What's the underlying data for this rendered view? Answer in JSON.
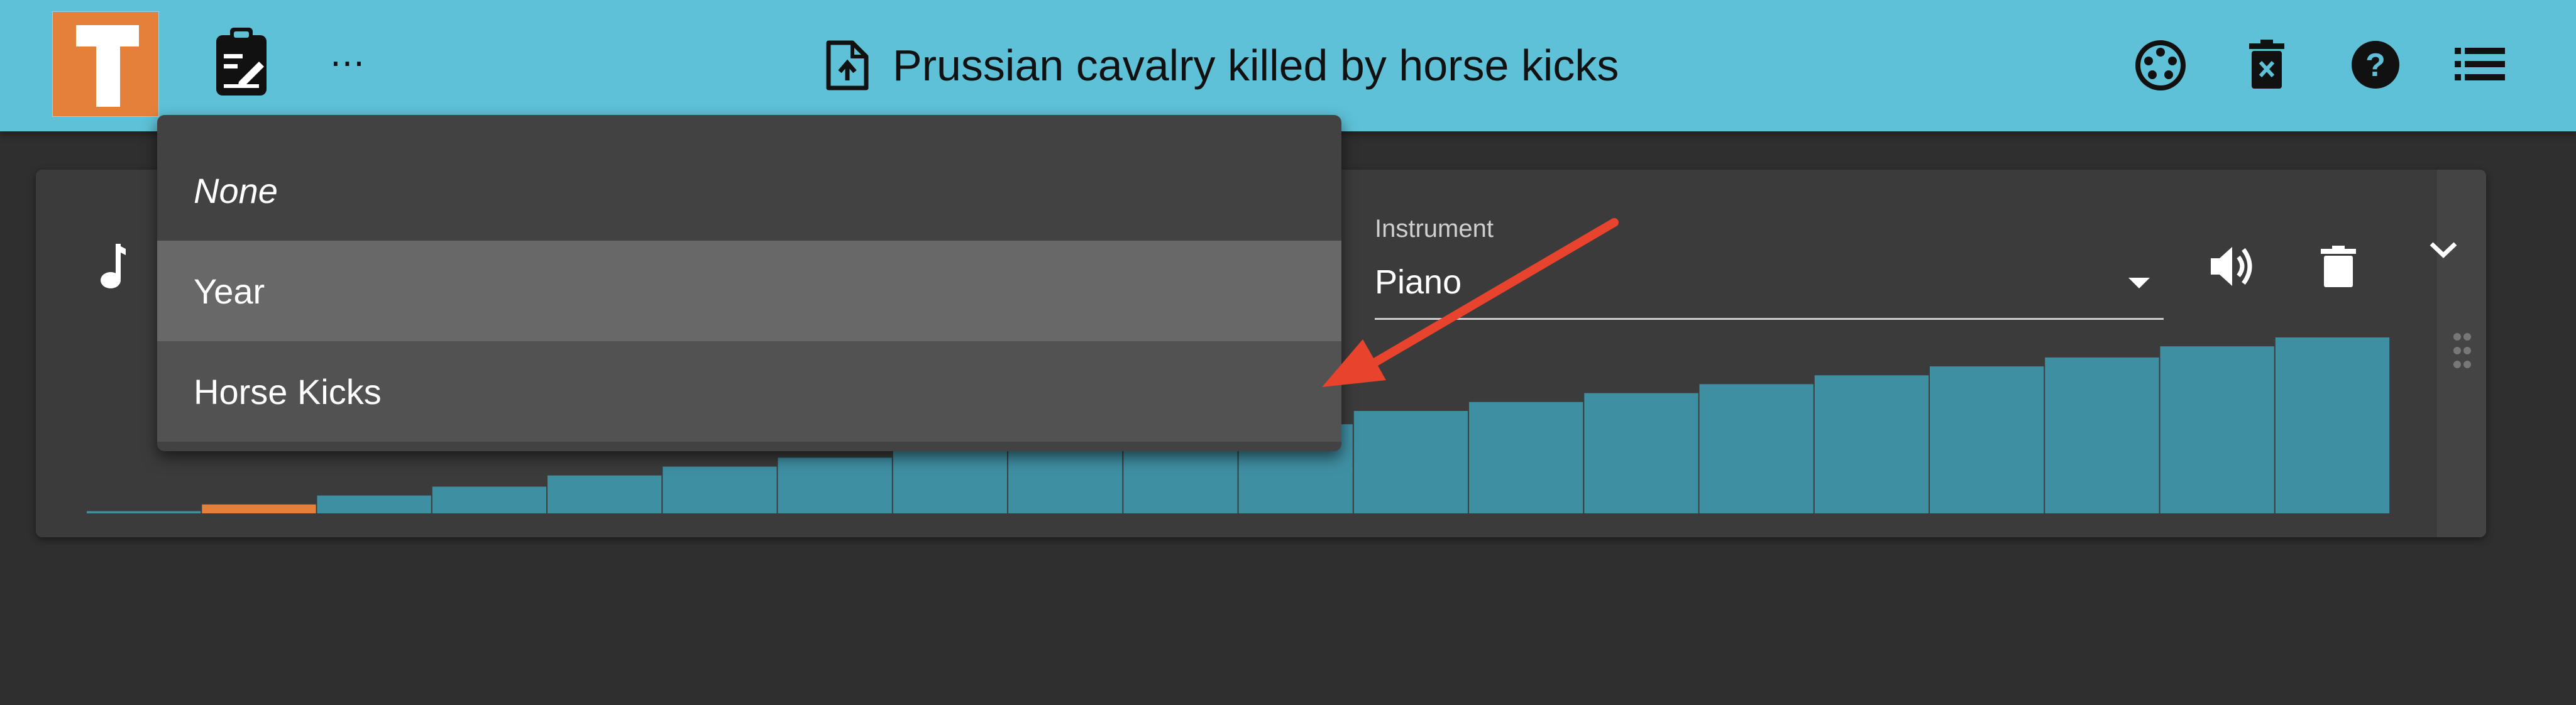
{
  "header": {
    "title": "Prussian cavalry killed by horse kicks",
    "more_label": "⋯",
    "icons": [
      "logo",
      "clipboard-edit-icon",
      "more-icon",
      "file-upload-icon",
      "palette-icon",
      "delete-all-icon",
      "help-icon",
      "menu-list-icon"
    ]
  },
  "track": {
    "instrument_label": "Instrument",
    "instrument_value": "Piano",
    "icons": [
      "music-note-icon",
      "volume-icon",
      "trash-icon",
      "chevron-down-icon",
      "drag-handle-icon"
    ]
  },
  "menu": {
    "items": [
      {
        "label": "None",
        "state": "default",
        "italic": true
      },
      {
        "label": "Year",
        "state": "selected",
        "italic": false
      },
      {
        "label": "Horse Kicks",
        "state": "hover",
        "italic": false
      }
    ]
  },
  "annotation": {
    "type": "arrow",
    "color": "#e8432d",
    "points_to": "Horse Kicks"
  },
  "colors": {
    "appbar": "#5ec1d7",
    "bar": "#3f8fa3",
    "bar_highlight": "#e5803b",
    "logo_orange": "#e5803b"
  },
  "chart_data": {
    "type": "bar",
    "title": "",
    "xlabel": "",
    "ylabel": "",
    "highlighted_index": 1,
    "values": [
      1,
      4,
      8,
      12,
      17,
      21,
      25,
      29,
      33,
      37,
      40,
      46,
      50,
      54,
      58,
      62,
      66,
      70,
      75,
      79
    ]
  }
}
